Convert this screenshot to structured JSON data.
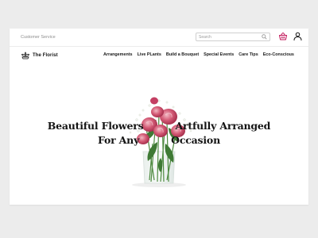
{
  "header": {
    "customer_service": "Customer Service",
    "search_placeholder": "Search",
    "icons": [
      "search-icon",
      "shopping-basket-icon",
      "user-icon"
    ]
  },
  "brand": {
    "name": "The Florist",
    "logo_icon": "flower-logo-icon"
  },
  "nav": {
    "items": [
      "Arrangements",
      "Live PLants",
      "Build a Bouquet",
      "Special Events",
      "Care Tips",
      "Eco-Conscious"
    ]
  },
  "hero": {
    "line1_left": "Beautiful Flowers",
    "line1_right": "Artfully Arranged",
    "line2_left": "For Any",
    "line2_right": "Occasion"
  },
  "colors": {
    "cart_accent": "#c2185b",
    "roses": "#c9506a",
    "foliage": "#3f7a35",
    "text": "#141414"
  }
}
